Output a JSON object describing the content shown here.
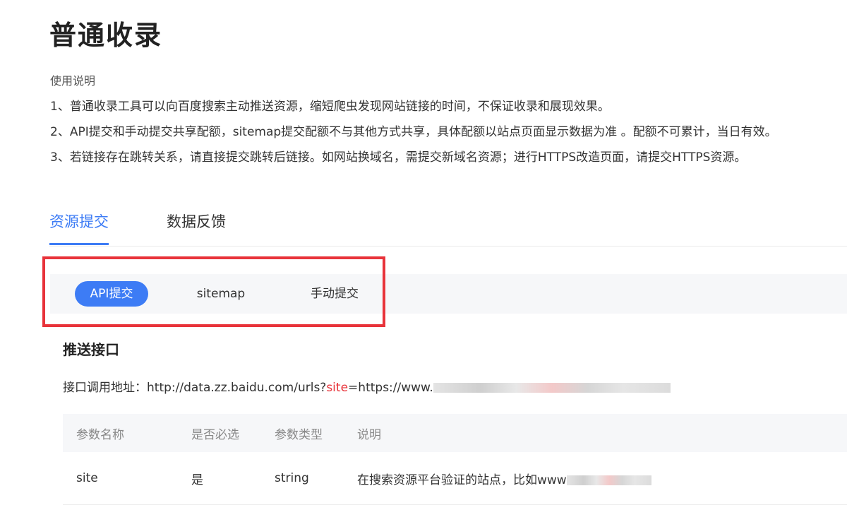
{
  "page": {
    "title": "普通收录"
  },
  "instructions": {
    "heading": "使用说明",
    "items": [
      "1、普通收录工具可以向百度搜索主动推送资源，缩短爬虫发现网站链接的时间，不保证收录和展现效果。",
      "2、API提交和手动提交共享配额，sitemap提交配额不与其他方式共享，具体配额以站点页面显示数据为准 。配额不可累计，当日有效。",
      "3、若链接存在跳转关系，请直接提交跳转后链接。如网站换域名，需提交新域名资源；进行HTTPS改造页面，请提交HTTPS资源。"
    ]
  },
  "tabs": [
    {
      "label": "资源提交",
      "active": true
    },
    {
      "label": "数据反馈",
      "active": false
    }
  ],
  "subtabs": [
    {
      "label": "API提交",
      "active": true
    },
    {
      "label": "sitemap",
      "active": false
    },
    {
      "label": "手动提交",
      "active": false
    }
  ],
  "push_api": {
    "title": "推送接口",
    "url_label": "接口调用地址：",
    "url_prefix": "http://data.zz.baidu.com/urls?",
    "url_param": "site",
    "url_suffix": "=https://www."
  },
  "table": {
    "headers": [
      "参数名称",
      "是否必选",
      "参数类型",
      "说明"
    ],
    "rows": [
      {
        "name": "site",
        "required": "是",
        "type": "string",
        "desc": "在搜索资源平台验证的站点，比如www"
      }
    ]
  },
  "colors": {
    "accent": "#3d7cf5",
    "highlight": "#e8333a",
    "param": "#e8333a"
  }
}
